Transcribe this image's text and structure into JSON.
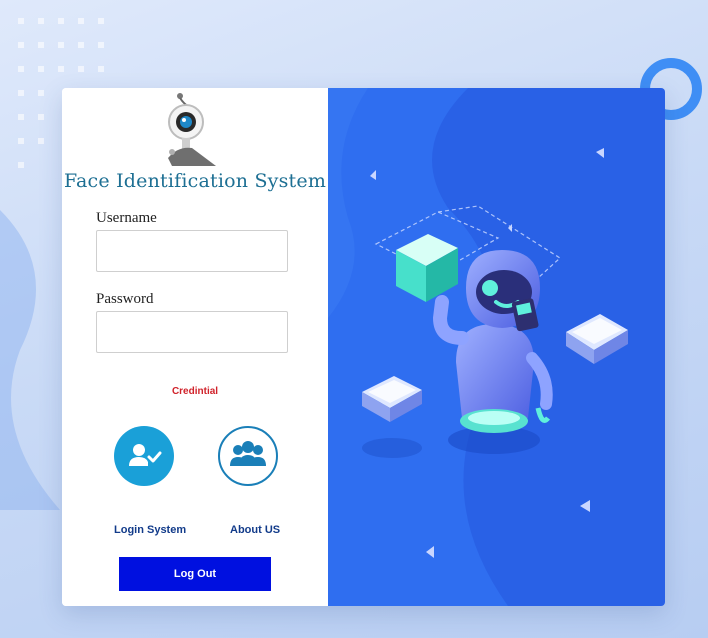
{
  "app": {
    "title": "Face Identification System"
  },
  "form": {
    "username_label": "Username",
    "username_value": "",
    "password_label": "Password",
    "password_value": "",
    "credential_text": "Credintial"
  },
  "actions": {
    "login_label": "Login System",
    "about_label": "About US",
    "logout_label": "Log Out"
  },
  "colors": {
    "accent_blue": "#2f6ef0",
    "logout_button": "#0010e0",
    "title_teal": "#1d6f93",
    "credential_red": "#d0222a"
  },
  "icons": {
    "logo": "webcam-icon",
    "login": "user-check-icon",
    "about": "group-icon",
    "illustration": "robot-illustration"
  }
}
